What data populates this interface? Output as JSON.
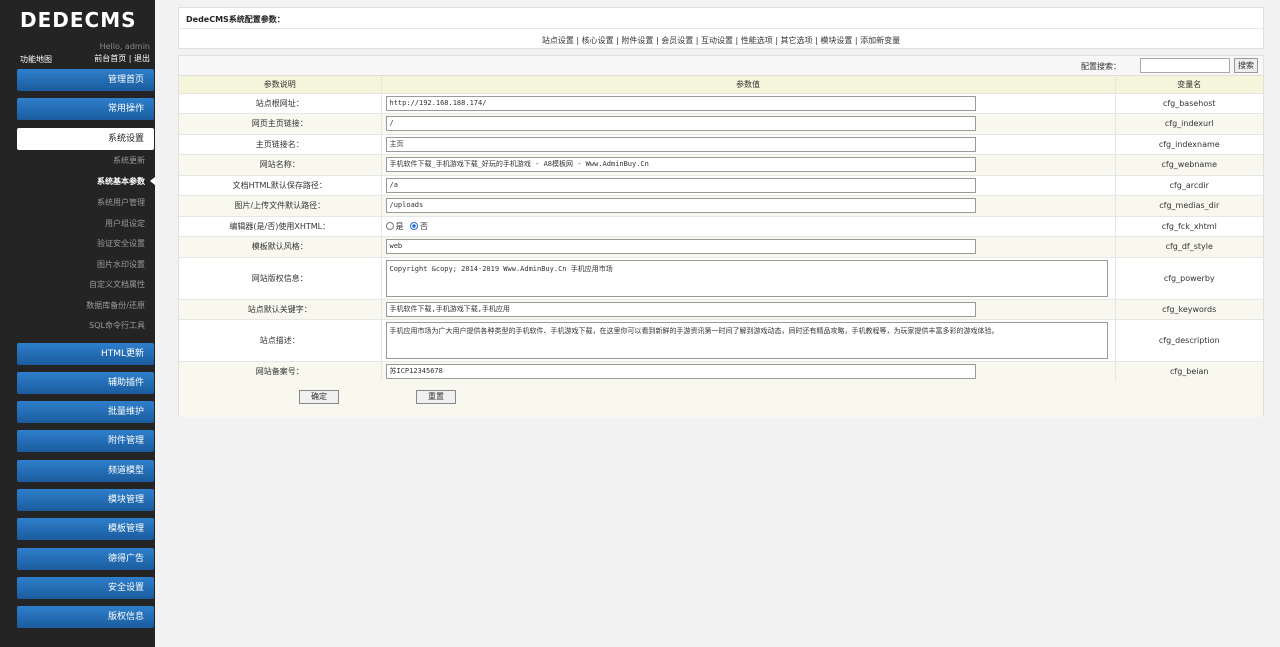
{
  "sidebar": {
    "logo": "DEDECMS",
    "hello": "Hello, admin",
    "sitemap": "功能地图",
    "frontpage": "前台首页",
    "sep": " | ",
    "logout": "退出",
    "menu": {
      "home": "管理首页",
      "common": "常用操作",
      "system": "系统设置",
      "html": "HTML更新",
      "plugins": "辅助插件",
      "batch": "批量维护",
      "attach": "附件管理",
      "channel": "频道模型",
      "module": "模块管理",
      "template": "模板管理",
      "ads": "德得广告",
      "security": "安全设置",
      "copyright": "版权信息"
    },
    "sub": {
      "update": "系统更新",
      "basic": "系统基本参数",
      "users": "系统用户管理",
      "groups": "用户组设定",
      "verify": "验证安全设置",
      "watermark": "图片水印设置",
      "custom": "自定义文档属性",
      "backup": "数据库备份/还原",
      "sql": "SQL命令行工具"
    }
  },
  "panel": {
    "title": "DedeCMS系统配置参数：",
    "links": "站点设置 | 核心设置 | 附件设置 | 会员设置 | 互动设置 | 性能选项 | 其它选项 | 模块设置 | 添加新变量"
  },
  "search": {
    "label": "配置搜索：",
    "button": "搜索"
  },
  "table": {
    "headers": {
      "desc": "参数说明",
      "value": "参数值",
      "var": "变量名"
    },
    "rows": [
      {
        "label": "站点根网址：",
        "value": "http://192.168.188.174/",
        "var": "cfg_basehost"
      },
      {
        "label": "网页主页链接：",
        "value": "/",
        "var": "cfg_indexurl"
      },
      {
        "label": "主页链接名：",
        "value": "主页",
        "var": "cfg_indexname"
      },
      {
        "label": "网站名称：",
        "value": "手机软件下载_手机游戏下载_好玩的手机游戏 - A8模板网 - Www.AdminBuy.Cn",
        "var": "cfg_webname"
      },
      {
        "label": "文档HTML默认保存路径：",
        "value": "/a",
        "var": "cfg_arcdir"
      },
      {
        "label": "图片/上传文件默认路径：",
        "value": "/uploads",
        "var": "cfg_medias_dir"
      },
      {
        "label": "编辑器(是/否)使用XHTML：",
        "yes": "是",
        "no": "否",
        "var": "cfg_fck_xhtml"
      },
      {
        "label": "模板默认风格：",
        "value": "web",
        "var": "cfg_df_style"
      },
      {
        "label": "网站版权信息：",
        "value": "Copyright &copy; 2014-2019 Www.AdminBuy.Cn 手机应用市场",
        "var": "cfg_powerby"
      },
      {
        "label": "站点默认关键字：",
        "value": "手机软件下载,手机游戏下载,手机应用",
        "var": "cfg_keywords"
      },
      {
        "label": "站点描述：",
        "value": "手机应用市场为广大用户提供各种类型的手机软件、手机游戏下载，在这里你可以看到新鲜的手游资讯第一时间了解到游戏动态，同时还有精品攻略，手机教程等，为玩家提供丰富多彩的游戏体验。",
        "var": "cfg_description"
      },
      {
        "label": "网站备案号：",
        "value": "苏ICP12345678",
        "var": "cfg_beian"
      }
    ]
  },
  "buttons": {
    "ok": "确定",
    "reset": "重置"
  }
}
